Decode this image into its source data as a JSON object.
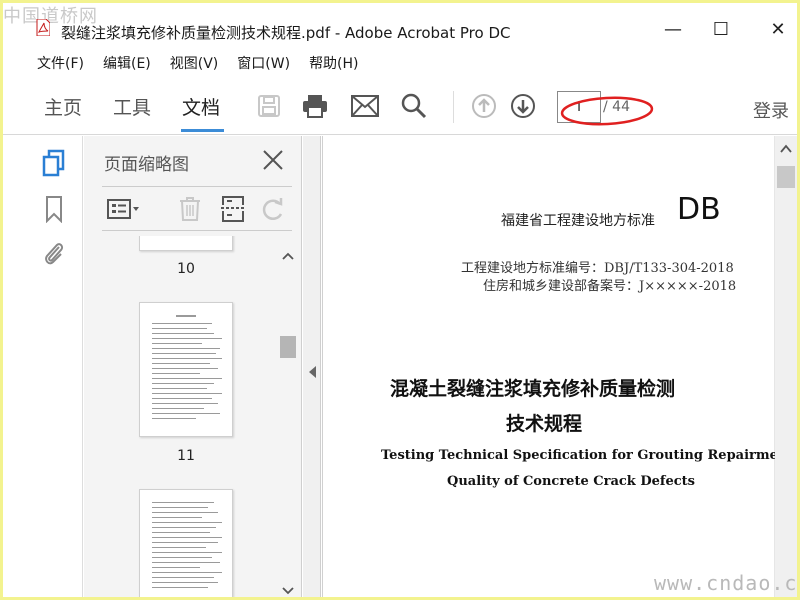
{
  "watermark_top": "中国道桥网",
  "watermark_bottom": "www.cndao.com",
  "window": {
    "title": "裂缝注浆填充修补质量检测技术规程.pdf - Adobe Acrobat Pro DC",
    "minimize_label": "—",
    "maximize_label": "☐",
    "close_label": "✕"
  },
  "menu": [
    "文件(F)",
    "编辑(E)",
    "视图(V)",
    "窗口(W)",
    "帮助(H)"
  ],
  "toolbar": {
    "tabs": [
      "主页",
      "工具",
      "文档"
    ],
    "active_tab": "文档",
    "icons": [
      "save-icon",
      "print-icon",
      "mail-icon",
      "search-icon",
      "page-up-icon",
      "page-down-icon"
    ],
    "page_value": "I",
    "page_total": "/ 44",
    "login": "登录",
    "accent_color": "#3c8cd7",
    "annotation_color": "#e02020"
  },
  "left_rail_icons": [
    "page-thumbnails-icon",
    "bookmark-icon",
    "attachment-icon"
  ],
  "thumbnails": {
    "title": "页面缩略图",
    "close_label": "✕",
    "tools": [
      "thumbnail-options-icon",
      "delete-page-icon",
      "insert-page-icon",
      "rotate-icon"
    ],
    "pages": [
      {
        "label": "10"
      },
      {
        "label": "11"
      }
    ]
  },
  "document": {
    "header_label": "福建省工程建设地方标准",
    "header_code": "DB",
    "std_number": "工程建设地方标准编号：DBJ/T133-304-2018",
    "record_number": "住房和城乡建设部备案号：J×××××-2018",
    "title_cn_line1": "混凝土裂缝注浆填充修补质量检测",
    "title_cn_line2": "技术规程",
    "title_en_line1": "Testing Technical Specification for Grouting Repairment",
    "title_en_line2": "Quality of Concrete Crack Defects"
  }
}
